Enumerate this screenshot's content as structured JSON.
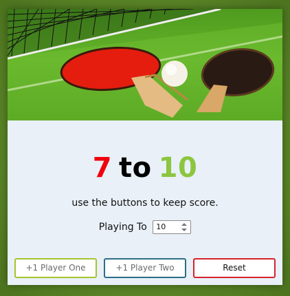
{
  "scoreboard": {
    "player_one_score": "7",
    "separator": "to",
    "player_two_score": "10"
  },
  "hint": "use the buttons to keep score.",
  "playing_to": {
    "label": "Playing To",
    "value": "10"
  },
  "buttons": {
    "player_one": "+1 Player One",
    "player_two": "+1 Player Two",
    "reset": "Reset"
  },
  "colors": {
    "player_one": "#f2000d",
    "player_two": "#8cc63f",
    "background": "#5e8c2b",
    "card": "#e9f0f8"
  }
}
